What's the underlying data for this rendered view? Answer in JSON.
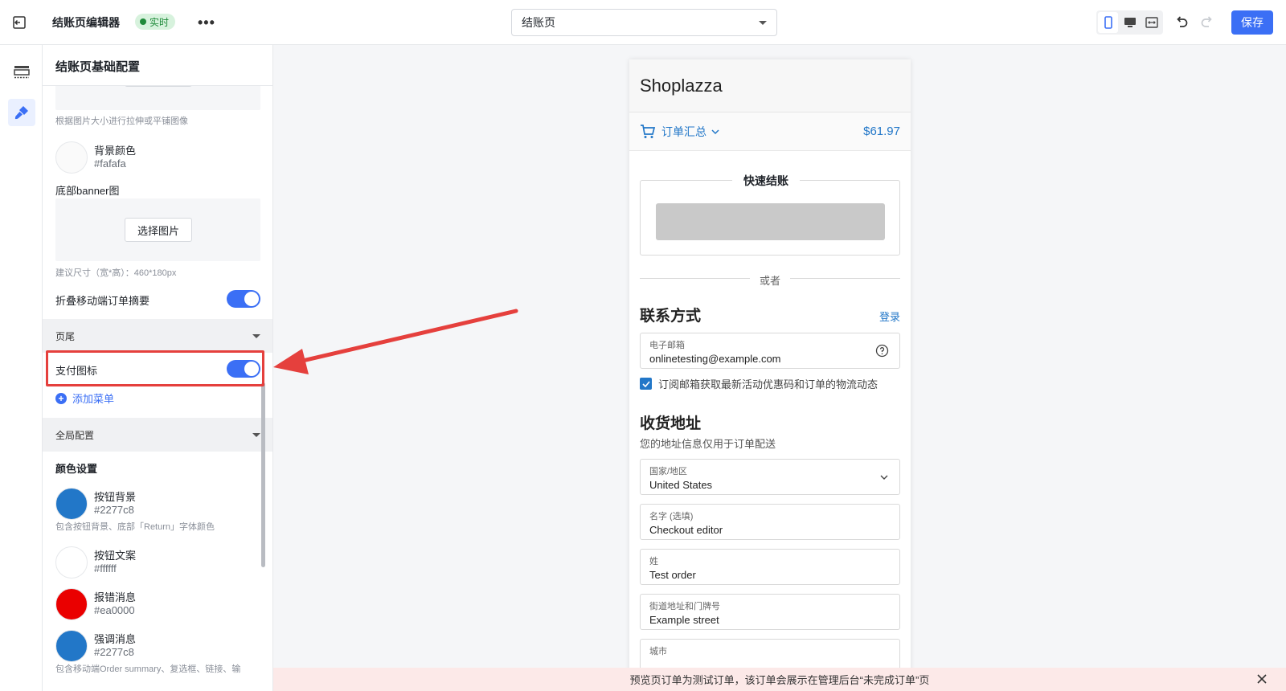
{
  "topbar": {
    "title": "结账页编辑器",
    "live_badge": "实时",
    "page_select": "结账页",
    "save_label": "保存"
  },
  "panel": {
    "title": "结账页基础配置",
    "bg_image_hint": "根据图片大小进行拉伸或平铺图像",
    "bg_color": {
      "name": "背景颜色",
      "hex": "#fafafa",
      "color": "#fafafa"
    },
    "footer_banner_label": "底部banner图",
    "choose_image": "选择图片",
    "banner_hint": "建议尺寸（宽*高）：460*180px",
    "collapse_mobile_summary": "折叠移动端订单摘要",
    "section_footer": "页尾",
    "payment_icons": "支付图标",
    "add_menu": "添加菜单",
    "section_global": "全局配置",
    "color_settings": "颜色设置",
    "colors": [
      {
        "name": "按钮背景",
        "hex": "#2277c8",
        "color": "#2277c8",
        "hint": "包含按钮背景、底部「Return」字体颜色"
      },
      {
        "name": "按钮文案",
        "hex": "#ffffff",
        "color": "#ffffff"
      },
      {
        "name": "报错消息",
        "hex": "#ea0000",
        "color": "#ea0000"
      },
      {
        "name": "强调消息",
        "hex": "#2277c8",
        "color": "#2277c8",
        "hint": "包含移动端Order summary、复选框、链接、输"
      }
    ]
  },
  "preview": {
    "store_name": "Shoplazza",
    "order_summary": "订单汇总",
    "total": "$61.97",
    "express_checkout": "快速结账",
    "or": "或者",
    "contact_title": "联系方式",
    "login": "登录",
    "email_label": "电子邮箱",
    "email_value": "onlinetesting@example.com",
    "subscribe_text": "订阅邮箱获取最新活动优惠码和订单的物流动态",
    "shipping_title": "收货地址",
    "shipping_sub": "您的地址信息仅用于订单配送",
    "fields": [
      {
        "label": "国家/地区",
        "value": "United States"
      },
      {
        "label": "名字 (选填)",
        "value": "Checkout editor"
      },
      {
        "label": "姓",
        "value": "Test order"
      },
      {
        "label": "街道地址和门牌号",
        "value": "Example street"
      },
      {
        "label": "城市",
        "value": ""
      }
    ]
  },
  "notice": "预览页订单为测试订单，该订单会展示在管理后台“未完成订单”页",
  "accent_color": "#3b6ff5",
  "highlight_color": "#e5403d"
}
